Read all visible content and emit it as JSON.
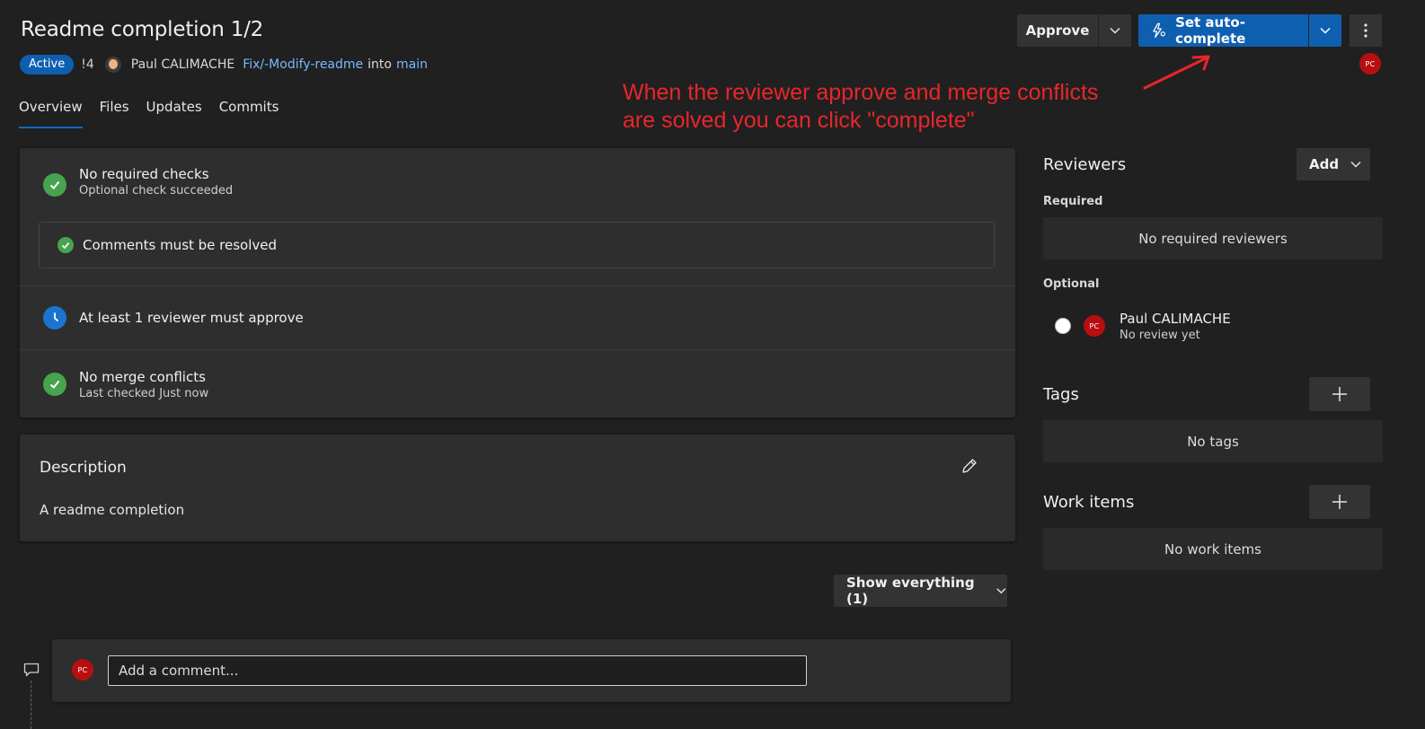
{
  "pr": {
    "title": "Readme completion 1/2",
    "status": "Active",
    "id": "!4",
    "author": "Paul CALIMACHE",
    "source_branch": "Fix/-Modify-readme",
    "into": "into",
    "target_branch": "main"
  },
  "toolbar": {
    "approve_label": "Approve",
    "auto_complete_label": "Set auto-complete",
    "user_initials": "PC"
  },
  "annotation": {
    "text": "When the reviewer approve and merge conflicts\nare solved you can click \"complete\"",
    "color": "#e8262b"
  },
  "tabs": [
    {
      "label": "Overview",
      "active": true
    },
    {
      "label": "Files",
      "active": false
    },
    {
      "label": "Updates",
      "active": false
    },
    {
      "label": "Commits",
      "active": false
    }
  ],
  "checks": {
    "required": {
      "title": "No required checks",
      "subtitle": "Optional check succeeded"
    },
    "comments": {
      "title": "Comments must be resolved"
    },
    "reviewer": {
      "title": "At least 1 reviewer must approve"
    },
    "merge": {
      "title": "No merge conflicts",
      "subtitle": "Last checked Just now"
    }
  },
  "description": {
    "title": "Description",
    "text": "A readme completion"
  },
  "show_button": {
    "label": "Show everything (1)"
  },
  "comment": {
    "placeholder": "Add a comment...",
    "avatar_initials": "PC"
  },
  "sidebar": {
    "reviewers_title": "Reviewers",
    "add_label": "Add",
    "required_label": "Required",
    "required_empty": "No required reviewers",
    "optional_label": "Optional",
    "reviewer": {
      "initials": "PC",
      "name": "Paul CALIMACHE",
      "status": "No review yet"
    },
    "tags_title": "Tags",
    "tags_empty": "No tags",
    "work_items_title": "Work items",
    "work_items_empty": "No work items"
  },
  "colors": {
    "accent": "#0f5fb0",
    "success": "#47a34f",
    "pending": "#1b74d0",
    "avatar": "#b70f0f",
    "link": "#79b8ff"
  }
}
